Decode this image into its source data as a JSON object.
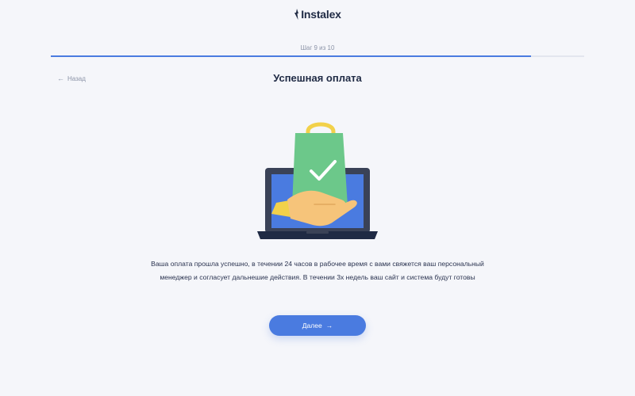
{
  "header": {
    "logo_text": "Instalex"
  },
  "progress": {
    "step_label": "Шаг 9 из 10",
    "fraction": 0.9
  },
  "nav": {
    "back_label": "Назад"
  },
  "main": {
    "title": "Успешная оплата",
    "message": "Ваша оплата прошла успешно, в течении 24 часов в рабочее время с вами свяжется ваш персональный менеджер и согласует дальнешие действия. В течении 3х недель ваш сайт и система будут готовы",
    "next_label": "Далее"
  },
  "icons": {
    "back": "arrow-left-icon",
    "next": "arrow-right-icon",
    "illustration": "laptop-shopping-bag-checkmark-illustration"
  },
  "colors": {
    "accent": "#4a7be0",
    "bag": "#6cc88a",
    "handle": "#f2d14a",
    "laptop": "#3a4257",
    "hand": "#f6c47a"
  }
}
